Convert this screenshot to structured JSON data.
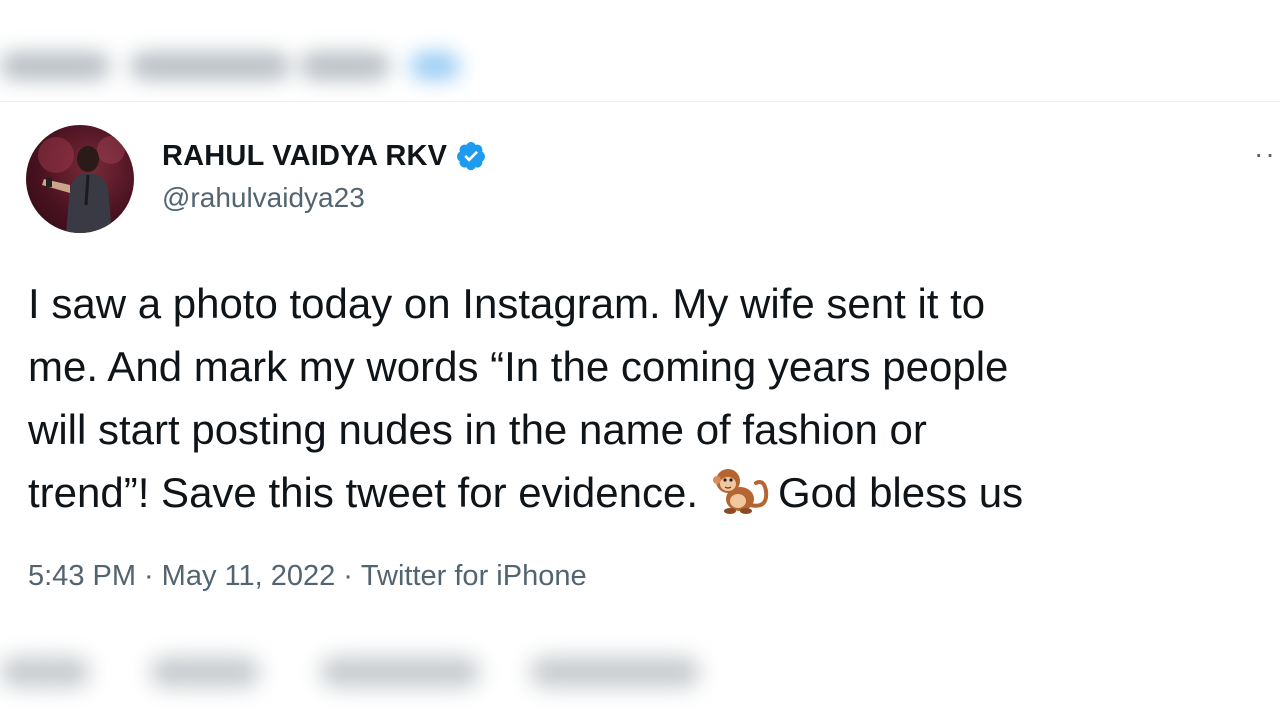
{
  "tweet": {
    "display_name": "RAHUL VAIDYA RKV",
    "handle": "@rahulvaidya23",
    "more_label": "··",
    "icons": {
      "verified": "verified-badge-icon",
      "avatar": "profile-photo",
      "emoji": "monkey-emoji"
    },
    "text_lines": [
      "I saw a photo today on Instagram. My wife sent it to",
      "me. And mark my words “In the coming years people",
      "will start posting nudes in the name of fashion or",
      "trend”! Save this tweet for evidence.",
      "God bless us"
    ],
    "time": "5:43 PM",
    "separator": "·",
    "date": "May 11, 2022",
    "source": "Twitter for iPhone"
  },
  "colors": {
    "text_primary": "#0f1419",
    "text_secondary": "#536471",
    "verified_blue": "#1d9bf0",
    "background": "#ffffff"
  }
}
